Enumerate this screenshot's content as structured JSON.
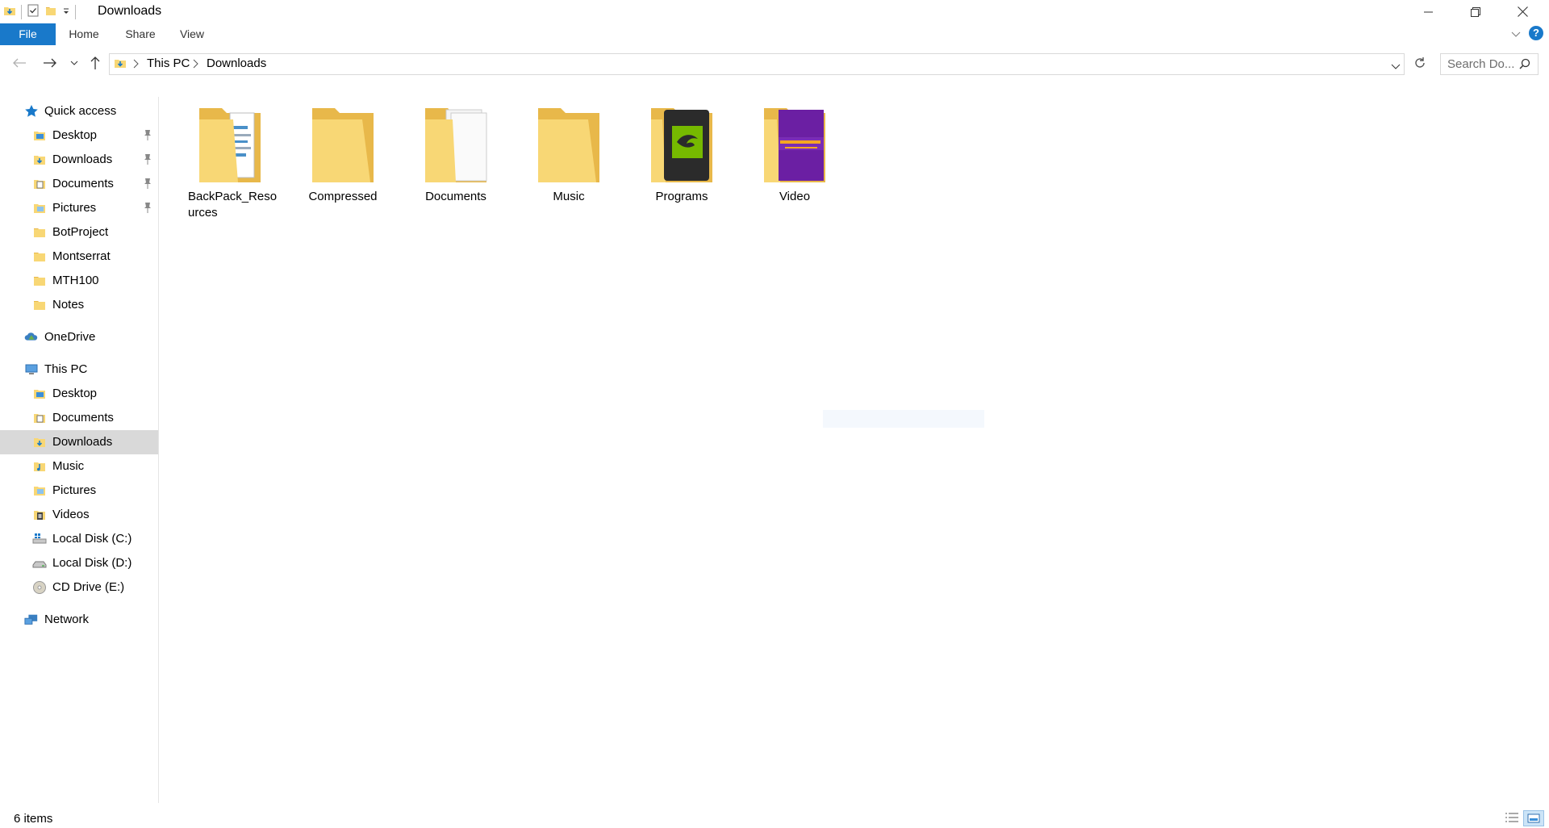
{
  "window": {
    "title": "Downloads"
  },
  "ribbon": {
    "tabs": [
      "File",
      "Home",
      "Share",
      "View"
    ]
  },
  "address": {
    "breadcrumbs": [
      "This PC",
      "Downloads"
    ],
    "search_placeholder": "Search Do..."
  },
  "sidebar": {
    "quick_access": {
      "label": "Quick access",
      "items": [
        {
          "label": "Desktop",
          "icon": "desktop-folder-icon",
          "pinned": true
        },
        {
          "label": "Downloads",
          "icon": "downloads-folder-icon",
          "pinned": true
        },
        {
          "label": "Documents",
          "icon": "documents-folder-icon",
          "pinned": true
        },
        {
          "label": "Pictures",
          "icon": "pictures-folder-icon",
          "pinned": true
        },
        {
          "label": "BotProject",
          "icon": "folder-icon",
          "pinned": false
        },
        {
          "label": "Montserrat",
          "icon": "folder-icon",
          "pinned": false
        },
        {
          "label": "MTH100",
          "icon": "folder-icon",
          "pinned": false
        },
        {
          "label": "Notes",
          "icon": "folder-icon",
          "pinned": false
        }
      ]
    },
    "onedrive": {
      "label": "OneDrive"
    },
    "this_pc": {
      "label": "This PC",
      "items": [
        {
          "label": "Desktop",
          "icon": "desktop-folder-icon"
        },
        {
          "label": "Documents",
          "icon": "documents-folder-icon"
        },
        {
          "label": "Downloads",
          "icon": "downloads-folder-icon",
          "selected": true
        },
        {
          "label": "Music",
          "icon": "music-folder-icon"
        },
        {
          "label": "Pictures",
          "icon": "pictures-folder-icon"
        },
        {
          "label": "Videos",
          "icon": "videos-folder-icon"
        },
        {
          "label": "Local Disk (C:)",
          "icon": "system-drive-icon"
        },
        {
          "label": "Local Disk (D:)",
          "icon": "drive-icon"
        },
        {
          "label": "CD Drive (E:)",
          "icon": "cd-drive-icon"
        }
      ]
    },
    "network": {
      "label": "Network"
    }
  },
  "folders": [
    {
      "name": "BackPack_Resources",
      "thumb": "documents"
    },
    {
      "name": "Compressed",
      "thumb": "empty"
    },
    {
      "name": "Documents",
      "thumb": "papers"
    },
    {
      "name": "Music",
      "thumb": "empty"
    },
    {
      "name": "Programs",
      "thumb": "nvidia"
    },
    {
      "name": "Video",
      "thumb": "banana"
    }
  ],
  "status": {
    "item_count": "6 items"
  },
  "colors": {
    "accent": "#1979ca",
    "folder": "#f8d775",
    "folder_dark": "#e8b84a",
    "selection": "#d9d9d9"
  }
}
